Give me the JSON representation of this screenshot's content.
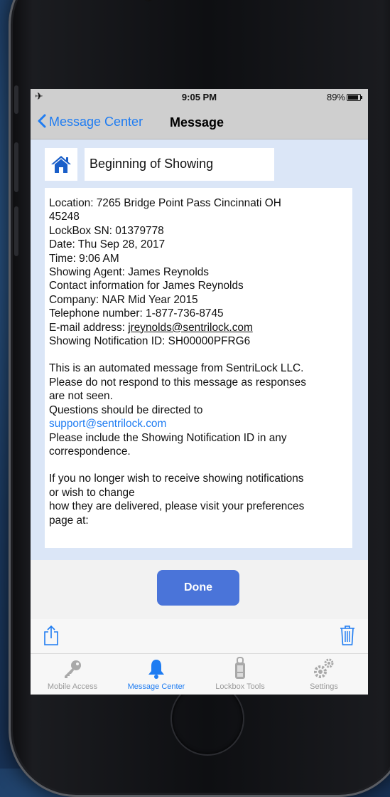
{
  "status_bar": {
    "time": "9:05 PM",
    "battery": "89%",
    "battery_level": 0.89
  },
  "nav": {
    "back_label": "Message Center",
    "title": "Message"
  },
  "subject": "Beginning of Showing",
  "message": {
    "line1": "Location: 7265 Bridge Point Pass Cincinnati OH",
    "line2": "45248",
    "lockbox": "LockBox SN: 01379778",
    "date": "Date: Thu Sep 28, 2017",
    "time": "Time: 9:06 AM",
    "agent": "Showing Agent: James Reynolds",
    "contact": "Contact information for James Reynolds",
    "company": "Company: NAR Mid Year 2015",
    "phone": "Telephone number: 1-877-736-8745",
    "email_prefix": "E-mail address: ",
    "email": "jreynolds@sentrilock.com",
    "notification_id": "Showing Notification ID: SH00000PFRG6",
    "auto1": "This is an automated message from SentriLock LLC.",
    "auto2": "Please do not respond to this message as responses",
    "auto3": "are not seen.",
    "questions": "Questions should be directed to",
    "support_email": "support@sentrilock.com",
    "include1": "Please include the Showing Notification ID in any",
    "include2": "correspondence.",
    "pref1": "If you no longer wish to receive showing notifications",
    "pref2": "or wish to change",
    "pref3": "how they are delivered, please visit your preferences",
    "pref4": "page at:"
  },
  "done_label": "Done",
  "tabs": [
    {
      "label": "Mobile Access",
      "icon": "key-icon"
    },
    {
      "label": "Message Center",
      "icon": "bell-icon"
    },
    {
      "label": "Lockbox Tools",
      "icon": "lockbox-icon"
    },
    {
      "label": "Settings",
      "icon": "gears-icon"
    }
  ],
  "colors": {
    "accent": "#1e7cf2",
    "done_button": "#4a74d9",
    "content_bg": "#dbe6f7",
    "nav_bg": "#cfcfcf"
  }
}
